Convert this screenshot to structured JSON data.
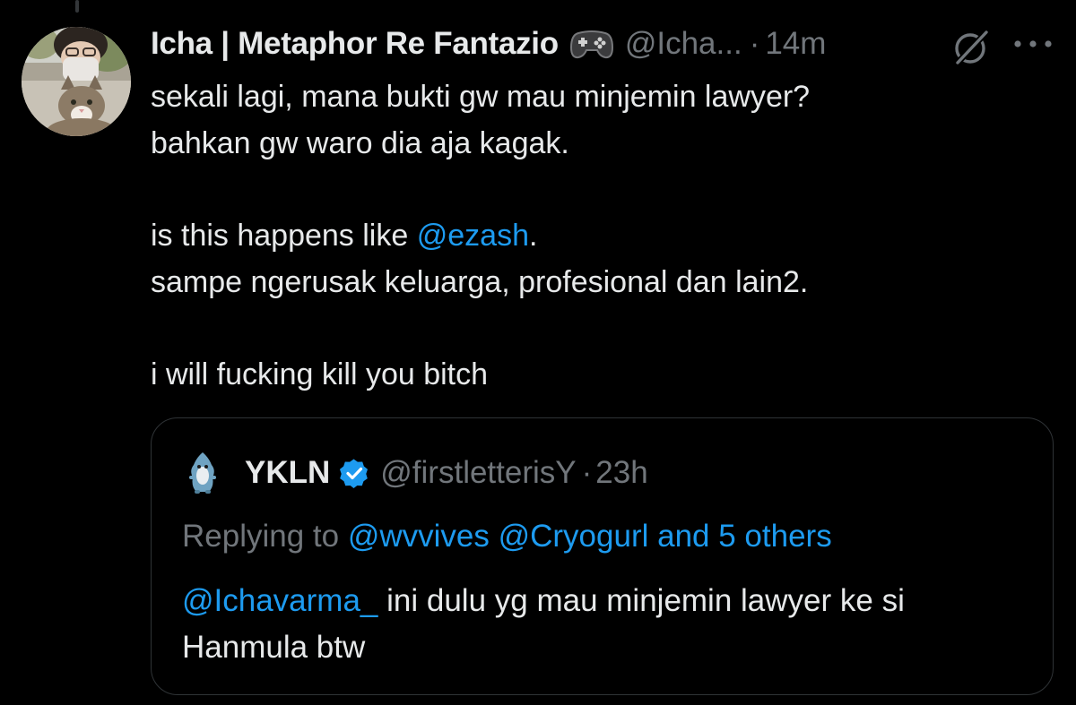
{
  "tweet": {
    "display_name": "Icha | Metaphor Re Fantazio",
    "emoji_icon": "game-controller-icon",
    "handle": "@Icha...",
    "separator": "·",
    "time": "14m",
    "lines": {
      "l1": "sekali lagi, mana bukti gw mau minjemin lawyer?",
      "l2": "bahkan gw waro dia aja kagak.",
      "l3_prefix": "is this happens like ",
      "l3_mention": "@ezash",
      "l3_suffix": ".",
      "l4": "sampe ngerusak keluarga, profesional dan lain2.",
      "l5": "i will fucking kill you bitch"
    }
  },
  "quoted": {
    "display_name": "YKLN",
    "verified": true,
    "handle": "@firstletterisY",
    "separator": "·",
    "time": "23h",
    "replying_prefix": "Replying to ",
    "replying_mentions": "@wvvives @Cryogurl and 5 others",
    "text_mention": "@Ichavarma_",
    "text_rest": " ini dulu yg mau minjemin lawyer ke si",
    "text_line2": "Hanmula btw"
  },
  "colors": {
    "background": "#000000",
    "text": "#e7e9ea",
    "secondary": "#71767b",
    "link": "#1d9bf0",
    "border": "#2f3336"
  }
}
